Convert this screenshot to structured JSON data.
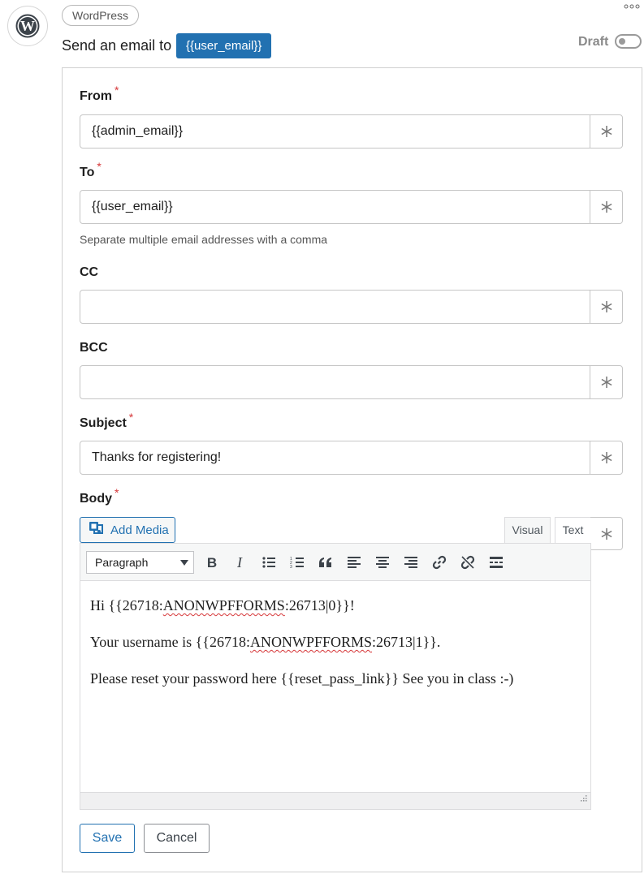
{
  "header": {
    "app_pill": "WordPress",
    "title_text": "Send an email to",
    "title_tag": "{{user_email}}",
    "status_label": "Draft"
  },
  "form": {
    "from": {
      "label": "From",
      "value": "{{admin_email}}",
      "required": "*"
    },
    "to": {
      "label": "To",
      "value": "{{user_email}}",
      "required": "*",
      "help": "Separate multiple email addresses with a comma"
    },
    "cc": {
      "label": "CC",
      "value": ""
    },
    "bcc": {
      "label": "BCC",
      "value": ""
    },
    "subject": {
      "label": "Subject",
      "value": "Thanks for registering!",
      "required": "*"
    },
    "body": {
      "label": "Body",
      "required": "*",
      "add_media": "Add Media",
      "tabs": {
        "visual": "Visual",
        "text": "Text"
      },
      "format_select": "Paragraph",
      "line1_pre": "Hi {{26718:",
      "line1_spell": "ANONWPFFORMS",
      "line1_post": ":26713|0}}!",
      "line2_pre": "Your username is {{26718:",
      "line2_spell": "ANONWPFFORMS",
      "line2_post": ":26713|1}}.",
      "line3": "Please reset your password here {{reset_pass_link}} See you in class :-)"
    }
  },
  "actions": {
    "save": "Save",
    "cancel": "Cancel"
  },
  "colors": {
    "accent": "#2271b1",
    "required": "#d63638"
  }
}
